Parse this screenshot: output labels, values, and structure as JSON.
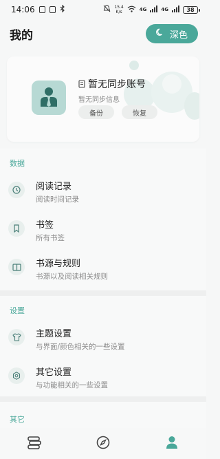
{
  "status_bar": {
    "time": "14:06",
    "network_speed_top": "15.4",
    "network_speed_unit": "K/s",
    "signal_1": "4G",
    "signal_2": "4G",
    "battery": "38"
  },
  "header": {
    "title": "我的",
    "theme_button_label": "深色"
  },
  "account": {
    "name": "暂无同步账号",
    "subtitle": "暂无同步信息",
    "backup_label": "备份",
    "restore_label": "恢复"
  },
  "sections": {
    "data": {
      "title": "数据",
      "items": [
        {
          "icon": "clock-icon",
          "title": "阅读记录",
          "subtitle": "阅读时间记录"
        },
        {
          "icon": "bookmark-icon",
          "title": "书签",
          "subtitle": "所有书签"
        },
        {
          "icon": "book-source-icon",
          "title": "书源与规则",
          "subtitle": "书源以及阅读相关规则"
        }
      ]
    },
    "settings": {
      "title": "设置",
      "items": [
        {
          "icon": "shirt-icon",
          "title": "主题设置",
          "subtitle": "与界面/颜色相关的一些设置"
        },
        {
          "icon": "cog-icon",
          "title": "其它设置",
          "subtitle": "与功能相关的一些设置"
        }
      ]
    },
    "other": {
      "title": "其它"
    }
  },
  "bottom_nav": {
    "items": [
      {
        "icon": "bookshelf-icon",
        "active": false
      },
      {
        "icon": "compass-icon",
        "active": false
      },
      {
        "icon": "person-icon",
        "active": true
      }
    ]
  },
  "colors": {
    "accent": "#4aa89a",
    "avatar_bg": "#b7d9d4",
    "avatar_fg": "#2f6e66"
  }
}
